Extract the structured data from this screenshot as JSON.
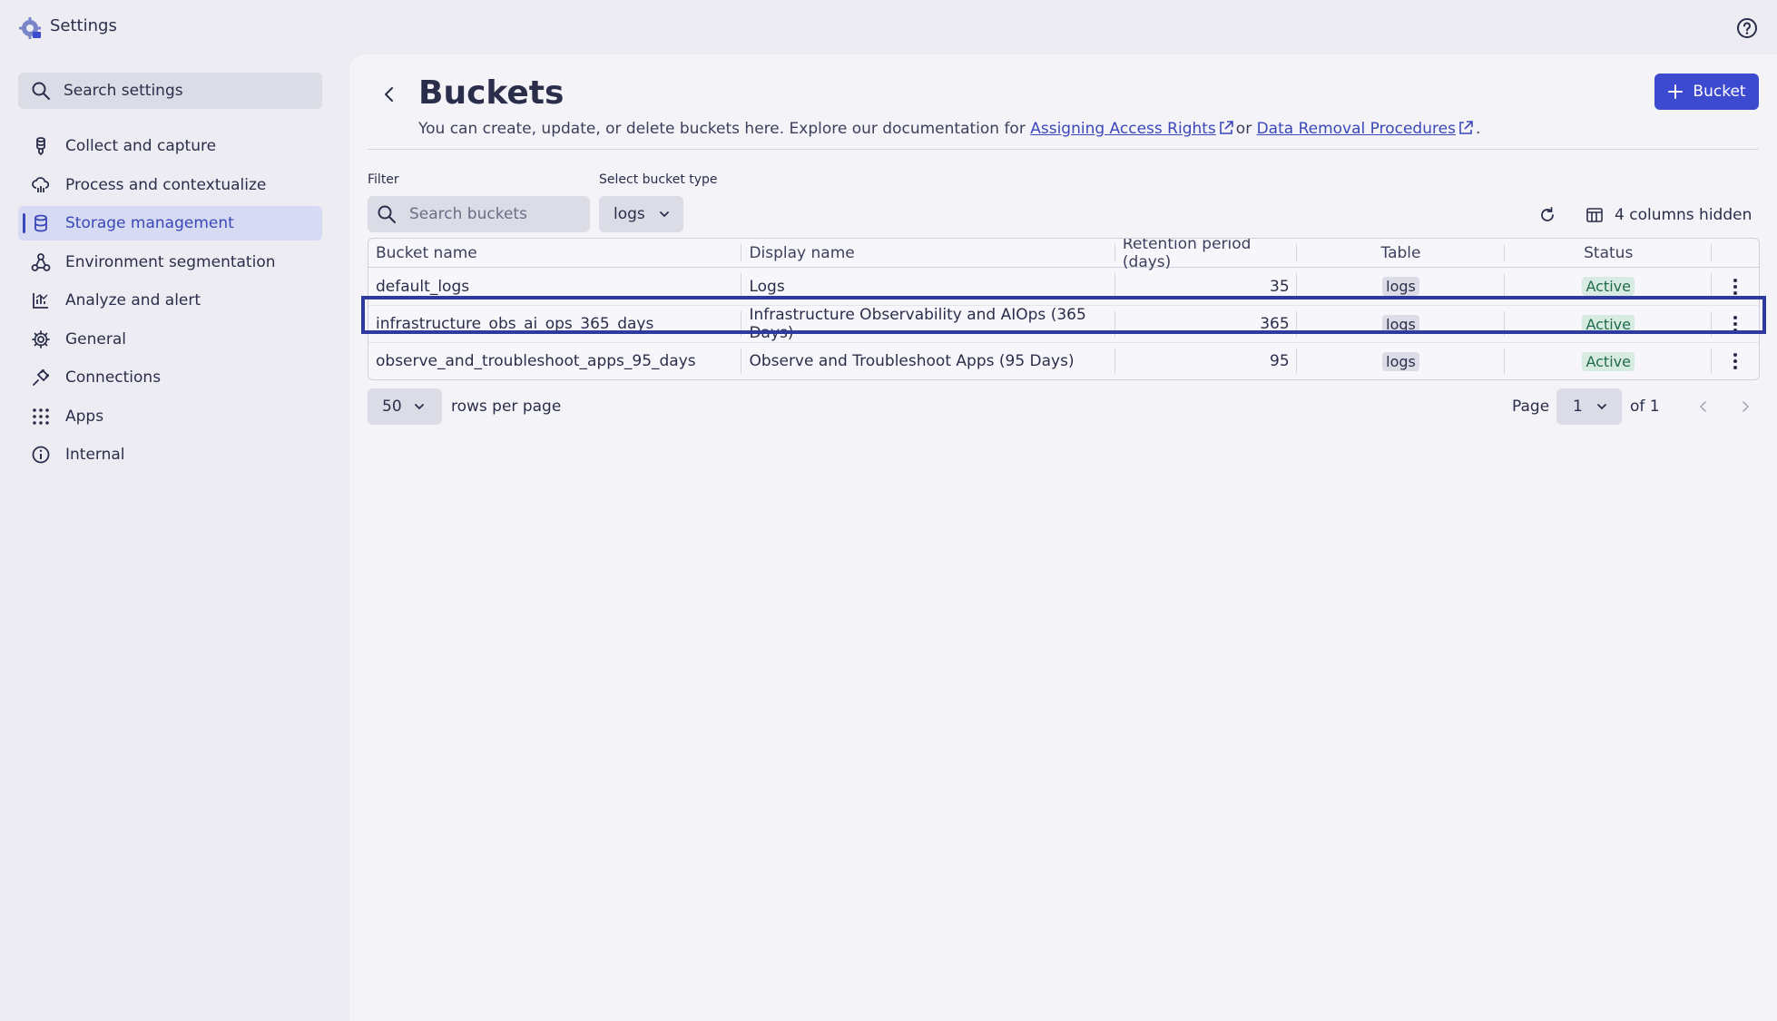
{
  "app": {
    "title": "Settings"
  },
  "sidebar": {
    "search_label": "Search settings",
    "items": [
      {
        "label": "Collect and capture",
        "icon": "collect-icon"
      },
      {
        "label": "Process and contextualize",
        "icon": "cloud-process-icon"
      },
      {
        "label": "Storage management",
        "icon": "database-icon",
        "active": true
      },
      {
        "label": "Environment segmentation",
        "icon": "segmentation-icon"
      },
      {
        "label": "Analyze and alert",
        "icon": "chart-icon"
      },
      {
        "label": "General",
        "icon": "gear-icon"
      },
      {
        "label": "Connections",
        "icon": "plug-icon"
      },
      {
        "label": "Apps",
        "icon": "grid-icon"
      },
      {
        "label": "Internal",
        "icon": "info-icon"
      }
    ]
  },
  "header": {
    "title": "Buckets",
    "desc_prefix": "You can create, update, or delete buckets here. Explore our documentation for",
    "link1": "Assigning Access Rights",
    "desc_mid": "or",
    "link2": "Data Removal Procedures",
    "desc_suffix": ".",
    "add_button": "Bucket"
  },
  "filters": {
    "filter_label": "Filter",
    "search_placeholder": "Search buckets",
    "type_label": "Select bucket type",
    "type_value": "logs",
    "columns_hidden": "4 columns hidden"
  },
  "table": {
    "columns": [
      "Bucket name",
      "Display name",
      "Retention period (days)",
      "Table",
      "Status"
    ],
    "rows": [
      {
        "bucket": "default_logs",
        "display": "Logs",
        "retention": "35",
        "table": "logs",
        "status": "Active"
      },
      {
        "bucket": "infrastructure_obs_ai_ops_365_days",
        "display": "Infrastructure Observability and AIOps (365 Days)",
        "retention": "365",
        "table": "logs",
        "status": "Active"
      },
      {
        "bucket": "observe_and_troubleshoot_apps_95_days",
        "display": "Observe and Troubleshoot Apps (95 Days)",
        "retention": "95",
        "table": "logs",
        "status": "Active"
      }
    ]
  },
  "pagination": {
    "rows_per_page_value": "50",
    "rows_per_page_label": "rows per page",
    "page_label": "Page",
    "page_value": "1",
    "of_label": "of 1"
  },
  "colors": {
    "accent": "#3c4ad0",
    "active_nav_bg": "#d6daf2",
    "status_bg": "#d8ebe2",
    "status_text": "#1f6b4a",
    "highlight": "#2e3a9e"
  }
}
